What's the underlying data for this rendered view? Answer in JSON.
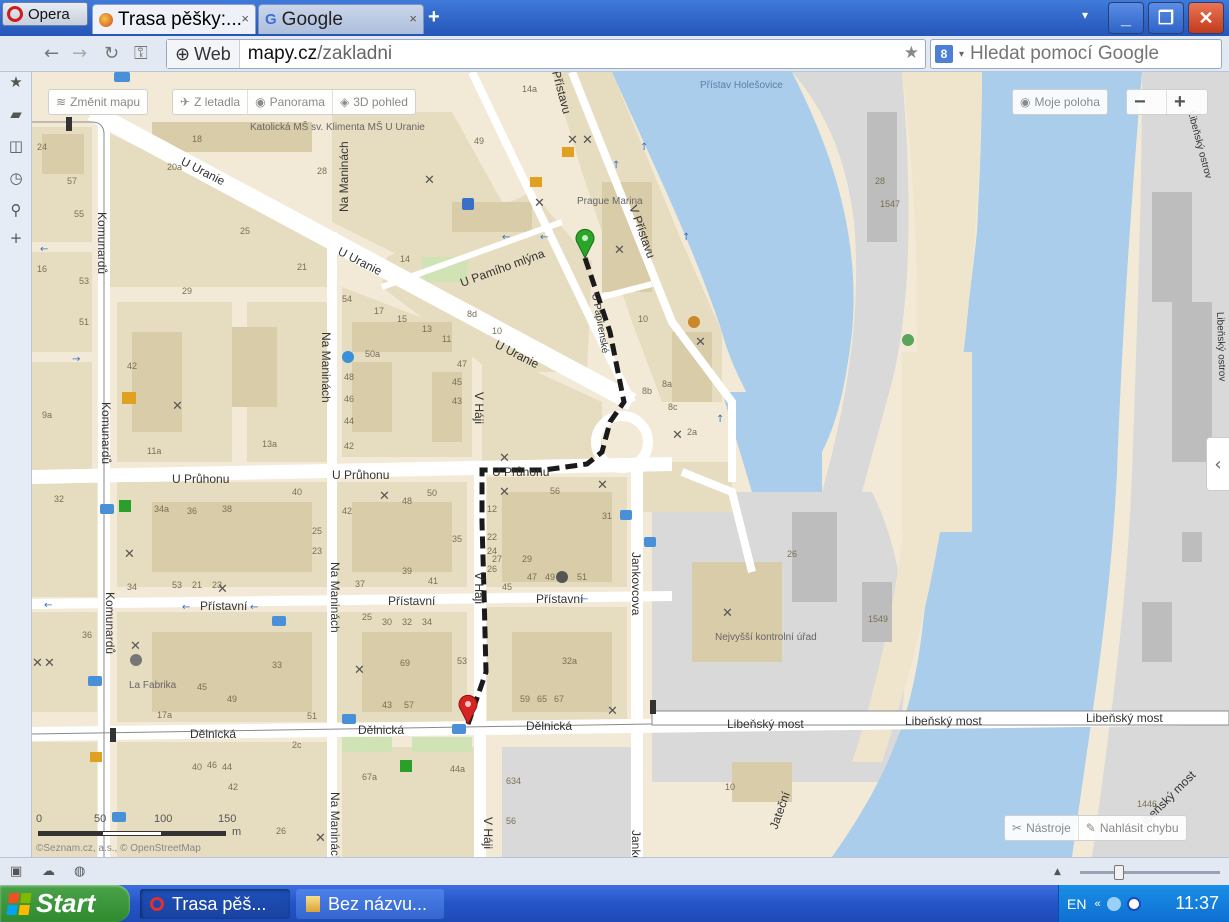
{
  "browser": {
    "opera_button": "Opera",
    "tabs": [
      {
        "label": "Trasa pěšky:...",
        "active": true
      },
      {
        "label": "Google",
        "active": false
      }
    ],
    "new_tab": "+",
    "address": {
      "badge": "Web",
      "domain": "mapy.cz",
      "path": "/zakladni"
    },
    "search_placeholder": "Hledat pomocí Google"
  },
  "map": {
    "toolbar_left": [
      {
        "label": "Změnit mapu",
        "icon": "layers-icon"
      },
      {
        "label": "Z letadla",
        "icon": "plane-icon"
      },
      {
        "label": "Panorama",
        "icon": "panorama-icon"
      },
      {
        "label": "3D pohled",
        "icon": "cube-icon"
      }
    ],
    "my_location": "Moje poloha",
    "zoom_out": "−",
    "zoom_in": "+",
    "tools": "Nástroje",
    "report_error": "Nahlásit chybu",
    "attribution": "©Seznam.cz, a.s., © OpenStreetMap",
    "scale_labels": [
      "0",
      "50",
      "100",
      "150",
      "m"
    ],
    "street_labels": [
      "U Uranie",
      "U Uranie",
      "U Uranie",
      "Na Maninách",
      "Na Maninách",
      "Na Maninách",
      "Na Maninách",
      "U Průhonu",
      "U Průhonu",
      "U Průhonu",
      "Přístavní",
      "Přístavní",
      "Přístavní",
      "Dělnická",
      "Dělnická",
      "Dělnická",
      "Komunardů",
      "Komunardů",
      "Komunardů",
      "V Háji",
      "V Háji",
      "V Háji",
      "Jankovcova",
      "Jankovcova",
      "V Přístavu",
      "Přístavu",
      "U Papírenské",
      "U Pamího mlýna",
      "Libeňský most",
      "Libeňský most",
      "Libeňský most",
      "Jateční",
      "Libeňský most",
      "Libeňský ostrov",
      "Libeňský ostrov"
    ],
    "poi_labels": [
      "Přístav Holešovice",
      "Katolická MŠ sv. Klimenta MŠ U Uranie",
      "Prague Marina",
      "Nejvyšší kontrolní úřad",
      "La Fabrika"
    ],
    "house_numbers": [
      "14a",
      "18",
      "20a",
      "28",
      "49",
      "57",
      "55",
      "24",
      "25",
      "21",
      "29",
      "16",
      "53",
      "51",
      "14",
      "10",
      "54",
      "17",
      "15",
      "13",
      "11",
      "50a",
      "47",
      "48",
      "45",
      "46",
      "43",
      "44",
      "42",
      "9a",
      "42",
      "13a",
      "11a",
      "32",
      "34a",
      "36",
      "38",
      "40",
      "42",
      "48",
      "50",
      "56",
      "31",
      "25",
      "23",
      "27",
      "29",
      "34",
      "35",
      "37",
      "39",
      "41",
      "45",
      "47",
      "49",
      "51",
      "53",
      "21",
      "23",
      "25",
      "30",
      "32",
      "34",
      "36",
      "33",
      "17a",
      "45",
      "49",
      "51",
      "53",
      "43",
      "57",
      "59",
      "65",
      "67",
      "69",
      "32a",
      "67a",
      "26",
      "2a",
      "8c",
      "8a",
      "8b",
      "10",
      "8d",
      "12",
      "22",
      "24",
      "26",
      "28",
      "1547",
      "1549",
      "1446",
      "634",
      "56",
      "10",
      "2c",
      "46",
      "44",
      "40",
      "42",
      "44a",
      "26",
      "9a"
    ],
    "route_start_marker": "route-start",
    "route_end_marker": "route-end",
    "collapse_panel": "‹"
  },
  "taskbar": {
    "start": "Start",
    "tasks": [
      {
        "label": "Trasa pěš...",
        "active": true
      },
      {
        "label": "Bez názvu...",
        "active": false
      }
    ],
    "language": "EN",
    "clock": "11:37"
  },
  "colors": {
    "water": "#a9cdea",
    "land": "#f2ead6",
    "block": "#e6dcbf",
    "building": "#d9cca9",
    "park": "#cfe3b5",
    "industrial": "#d9d9d9",
    "road": "#ffffff",
    "route": "#1a1a1a",
    "marker_start": "#2aa52a",
    "marker_end": "#d62424"
  }
}
